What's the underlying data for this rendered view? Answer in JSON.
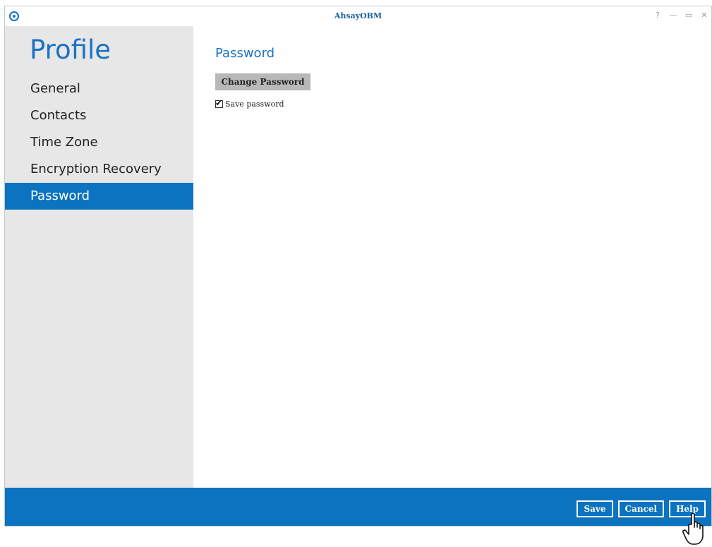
{
  "window": {
    "title": "AhsayOBM"
  },
  "window_controls": [
    "?",
    "—",
    "▭",
    "✕"
  ],
  "sidebar": {
    "title": "Profile",
    "items": [
      {
        "label": "General",
        "active": false
      },
      {
        "label": "Contacts",
        "active": false
      },
      {
        "label": "Time Zone",
        "active": false
      },
      {
        "label": "Encryption Recovery",
        "active": false
      },
      {
        "label": "Password",
        "active": true
      }
    ]
  },
  "main": {
    "title": "Password",
    "change_password_label": "Change Password",
    "save_password": {
      "label": "Save password",
      "checked": true
    }
  },
  "footer": {
    "save_label": "Save",
    "cancel_label": "Cancel",
    "help_label": "Help"
  },
  "colors": {
    "accent": "#0b73bf",
    "sidebar_bg": "#e7e7e7",
    "title_blue": "#1a72c4"
  },
  "icons": {
    "app_logo": "app-logo-icon",
    "cursor": "hand-pointer-icon"
  }
}
